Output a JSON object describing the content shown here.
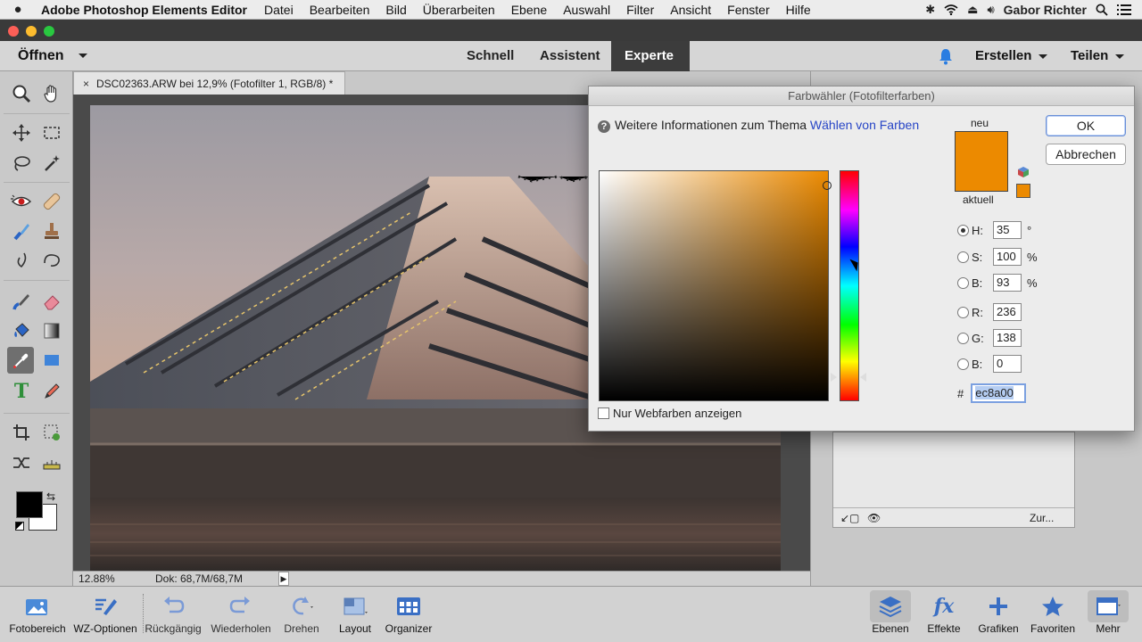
{
  "menubar": {
    "app_name": "Adobe Photoshop Elements Editor",
    "items": [
      "Datei",
      "Bearbeiten",
      "Bild",
      "Überarbeiten",
      "Ebene",
      "Auswahl",
      "Filter",
      "Ansicht",
      "Fenster",
      "Hilfe"
    ],
    "user": "Gabor Richter"
  },
  "toolbar": {
    "open_label": "Öffnen",
    "modes": [
      "Schnell",
      "Assistent",
      "Experte"
    ],
    "active_mode": "Experte",
    "create_label": "Erstellen",
    "share_label": "Teilen"
  },
  "document": {
    "tab_title": "DSC02363.ARW bei 12,9% (Fotofilter 1, RGB/8) *",
    "zoom": "12.88%",
    "doc_info": "Dok: 68,7M/68,7M"
  },
  "layers_panel": {
    "footer_label": "Zur..."
  },
  "color_picker": {
    "title": "Farbwähler (Fotofilterfarben)",
    "info_text": "Weitere Informationen zum Thema",
    "info_link": "Wählen von Farben",
    "new_label": "neu",
    "current_label": "aktuell",
    "ok_label": "OK",
    "cancel_label": "Abbrechen",
    "web_only_label": "Nur Webfarben anzeigen",
    "hex_prefix": "#",
    "hex": "ec8a00",
    "new_color": "#ec8a00",
    "fields": {
      "H": {
        "label": "H:",
        "value": "35",
        "unit": "°"
      },
      "S": {
        "label": "S:",
        "value": "100",
        "unit": "%"
      },
      "B": {
        "label": "B:",
        "value": "93",
        "unit": "%"
      },
      "R": {
        "label": "R:",
        "value": "236"
      },
      "G": {
        "label": "G:",
        "value": "138"
      },
      "B2": {
        "label": "B:",
        "value": "0"
      }
    }
  },
  "bottombar": {
    "items": [
      "Fotobereich",
      "WZ-Optionen",
      "Rückgängig",
      "Wiederholen",
      "Drehen",
      "Layout",
      "Organizer"
    ],
    "right_items": [
      "Ebenen",
      "Effekte",
      "Grafiken",
      "Favoriten",
      "Mehr"
    ]
  }
}
